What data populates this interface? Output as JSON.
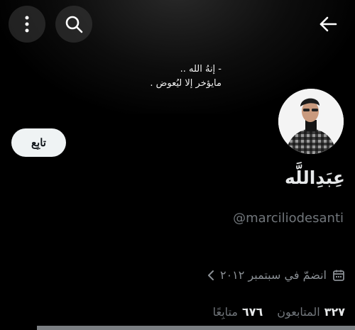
{
  "banner": {
    "quote_line1": "- إنهُ الله ..",
    "quote_line2": "مايؤخر إلا ليُعوض ."
  },
  "profile": {
    "display_name": "عِبَدِاللَّه",
    "handle": "@marciliodesanti",
    "joined": "انضمّ في سبتمبر ٢٠١٢"
  },
  "actions": {
    "follow_label": "تابِع"
  },
  "stats": {
    "followers_count": "٣٢٧",
    "followers_label": "المتابعون",
    "following_count": "٦٧٦",
    "following_label": "متابِعًا"
  },
  "icons": {
    "more": "more-vertical-icon",
    "search": "search-icon",
    "back": "arrow-back-icon",
    "calendar": "calendar-icon",
    "chevron": "chevron-left-icon"
  },
  "colors": {
    "background": "#000000",
    "text_primary": "#e7e9ea",
    "text_secondary": "#71767b",
    "button_bg": "#eff3f4"
  }
}
